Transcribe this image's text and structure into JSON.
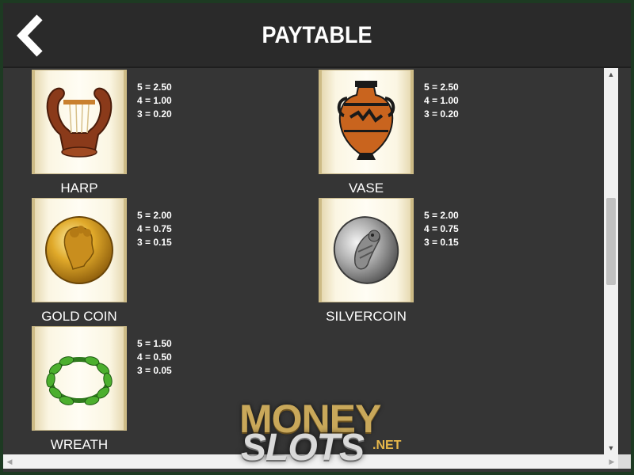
{
  "header": {
    "title": "PAYTABLE",
    "back_icon": "chevron-left-icon"
  },
  "symbols": [
    {
      "name": "HARP",
      "icon": "harp-icon",
      "pays": [
        "5 = 2.50",
        "4 = 1.00",
        "3 = 0.20"
      ]
    },
    {
      "name": "VASE",
      "icon": "vase-icon",
      "pays": [
        "5 = 2.50",
        "4 = 1.00",
        "3 = 0.20"
      ]
    },
    {
      "name": "GOLD COIN",
      "icon": "gold-coin-icon",
      "pays": [
        "5 = 2.00",
        "4 = 0.75",
        "3 = 0.15"
      ]
    },
    {
      "name": "SILVERCOIN",
      "icon": "silver-coin-icon",
      "pays": [
        "5 = 2.00",
        "4 = 0.75",
        "3 = 0.15"
      ]
    },
    {
      "name": "WREATH",
      "icon": "wreath-icon",
      "pays": [
        "5 = 1.50",
        "4 = 0.50",
        "3 = 0.05"
      ]
    }
  ],
  "logo": {
    "line1": "MONEY",
    "line2": "SLOTS",
    "suffix": ".NET"
  },
  "colors": {
    "background": "#353535",
    "header": "#2a2a2a",
    "text": "#ffffff",
    "tile": "#fbf6e3",
    "outer": "#1d3a22"
  }
}
